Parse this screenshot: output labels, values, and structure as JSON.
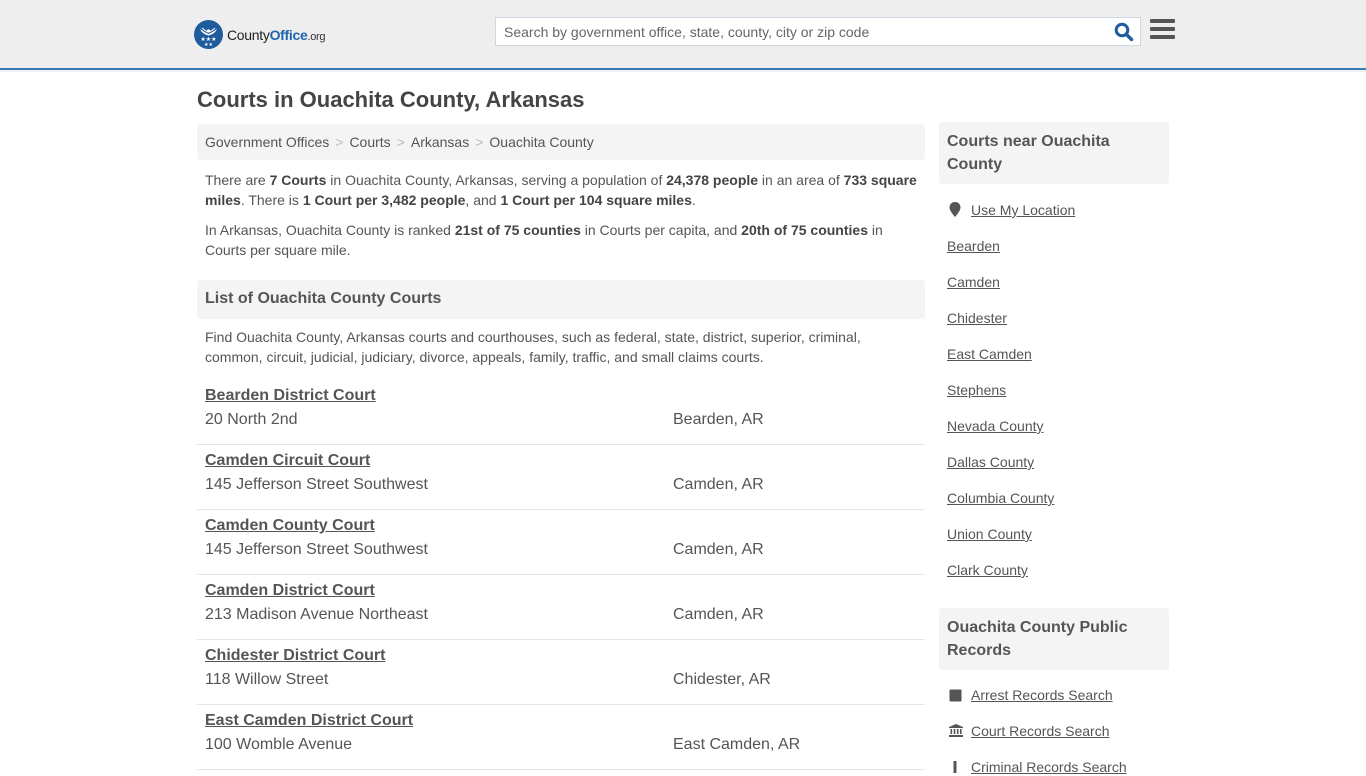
{
  "header": {
    "logo": {
      "prefix": "County",
      "brand": "Office",
      "tld": ".org"
    },
    "search": {
      "placeholder": "Search by government office, state, county, city or zip code",
      "value": ""
    },
    "search_icon": "search-icon",
    "menu_icon": "hamburger-menu-icon"
  },
  "page": {
    "title": "Courts in Ouachita County, Arkansas",
    "breadcrumb": [
      "Government Offices",
      "Courts",
      "Arkansas",
      "Ouachita County"
    ],
    "intro1": {
      "t1": "There are ",
      "b1": "7 Courts",
      "t2": " in Ouachita County, Arkansas, serving a population of ",
      "b2": "24,378 people",
      "t3": " in an area of ",
      "b3": "733 square miles",
      "t4": ". There is ",
      "b4": "1 Court per 3,482 people",
      "t5": ", and ",
      "b5": "1 Court per 104 square miles",
      "t6": "."
    },
    "intro2": {
      "t1": "In Arkansas, Ouachita County is ranked ",
      "b1": "21st of 75 counties",
      "t2": " in Courts per capita, and ",
      "b2": "20th of 75 counties",
      "t3": " in Courts per square mile."
    },
    "list_heading": "List of Ouachita County Courts",
    "list_description": "Find Ouachita County, Arkansas courts and courthouses, such as federal, state, district, superior, criminal, common, circuit, judicial, judiciary, divorce, appeals, family, traffic, and small claims courts.",
    "courts": [
      {
        "name": "Bearden District Court",
        "address": "20 North 2nd",
        "city": "Bearden, AR"
      },
      {
        "name": "Camden Circuit Court",
        "address": "145 Jefferson Street Southwest",
        "city": "Camden, AR"
      },
      {
        "name": "Camden County Court",
        "address": "145 Jefferson Street Southwest",
        "city": "Camden, AR"
      },
      {
        "name": "Camden District Court",
        "address": "213 Madison Avenue Northeast",
        "city": "Camden, AR"
      },
      {
        "name": "Chidester District Court",
        "address": "118 Willow Street",
        "city": "Chidester, AR"
      },
      {
        "name": "East Camden District Court",
        "address": "100 Womble Avenue",
        "city": "East Camden, AR"
      }
    ]
  },
  "sidebar": {
    "nearby_heading": "Courts near Ouachita County",
    "use_location": "Use My Location",
    "nearby": [
      "Bearden",
      "Camden",
      "Chidester",
      "East Camden",
      "Stephens",
      "Nevada County",
      "Dallas County",
      "Columbia County",
      "Union County",
      "Clark County"
    ],
    "records_heading": "Ouachita County Public Records",
    "records": [
      {
        "label": "Arrest Records Search",
        "icon": "square-icon"
      },
      {
        "label": "Court Records Search",
        "icon": "courthouse-icon"
      },
      {
        "label": "Criminal Records Search",
        "icon": "exclamation-icon"
      }
    ]
  }
}
